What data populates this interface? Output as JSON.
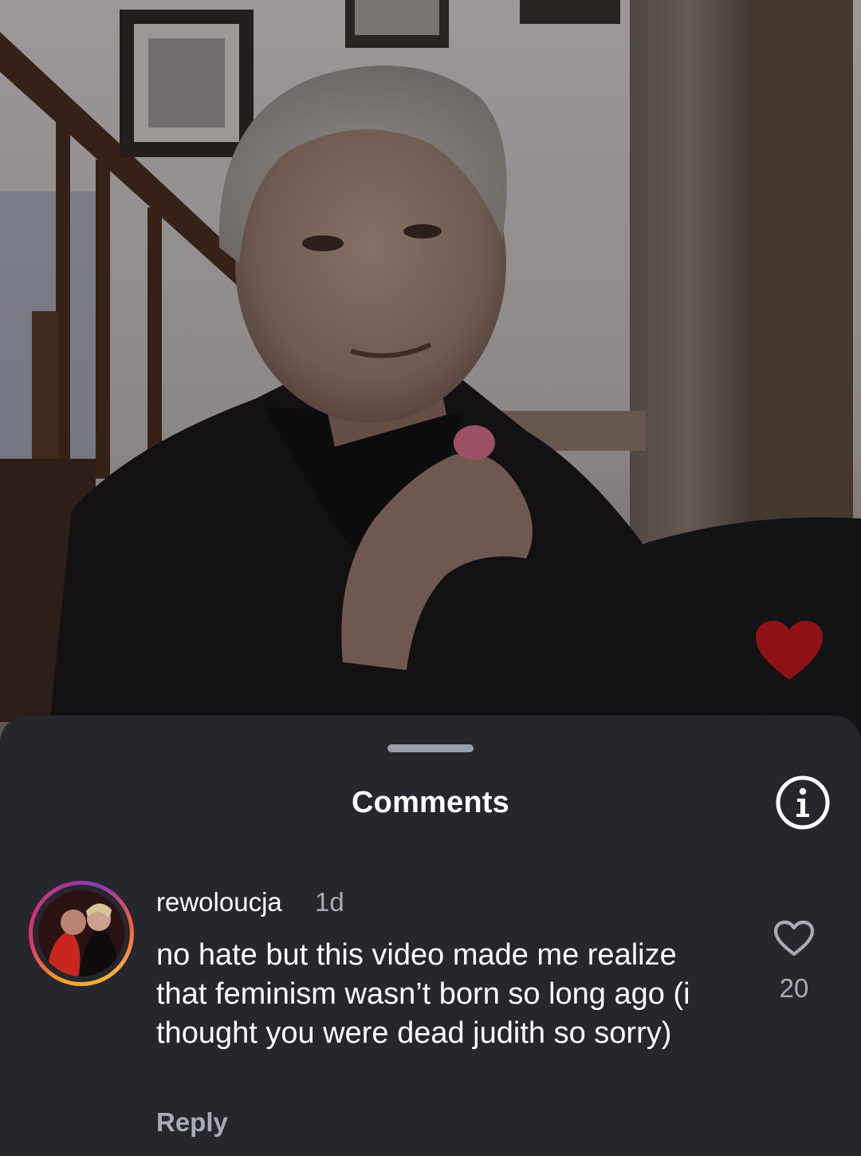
{
  "video": {
    "overlay_heart_color": "#8e1117"
  },
  "sheet": {
    "title": "Comments",
    "info_icon": "info-circle-icon"
  },
  "comment": {
    "username": "rewoloucja",
    "time": "1d",
    "text": "no hate but this video made me realize that feminism wasn’t born so long ago (i thought you were dead judith so sorry)",
    "reply_label": "Reply",
    "like_count": "20",
    "like_icon": "heart-outline-icon"
  },
  "colors": {
    "sheet_bg": "#25272c",
    "secondary_text": "#a8acb3",
    "primary_text": "#ffffff"
  }
}
